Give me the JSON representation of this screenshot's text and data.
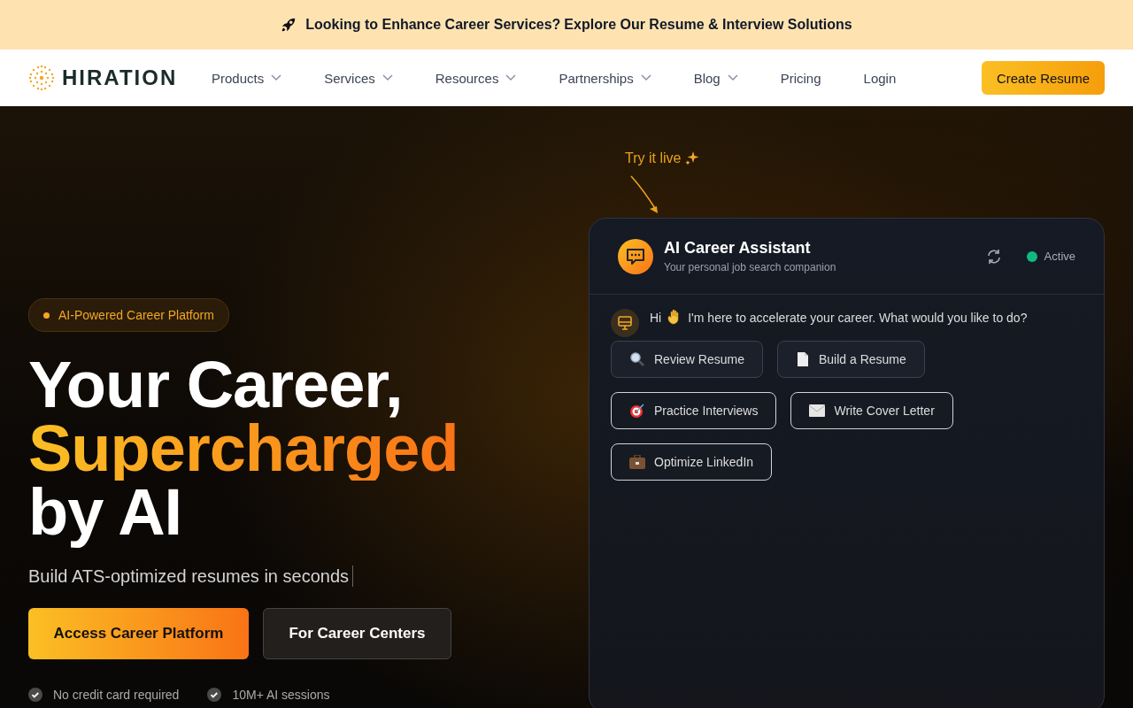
{
  "banner": {
    "question": "Looking to Enhance Career Services?",
    "link": "Explore Our Resume & Interview Solutions"
  },
  "nav": {
    "logo": "HIRATION",
    "items": [
      {
        "label": "Products",
        "dropdown": true
      },
      {
        "label": "Services",
        "dropdown": true
      },
      {
        "label": "Resources",
        "dropdown": true
      },
      {
        "label": "Partnerships",
        "dropdown": true
      },
      {
        "label": "Blog",
        "dropdown": true
      },
      {
        "label": "Pricing",
        "dropdown": false
      },
      {
        "label": "Login",
        "dropdown": false
      }
    ],
    "cta": "Create Resume"
  },
  "hero": {
    "badge": "AI-Powered Career Platform",
    "headline_1": "Your Career,",
    "headline_2": "Supercharged",
    "headline_3": "by AI",
    "subtitle": "Build ATS-optimized resumes in seconds",
    "primary_button": "Access Career Platform",
    "secondary_button": "For Career Centers",
    "features": [
      "No credit card required",
      "10M+ AI sessions"
    ]
  },
  "try_label": "Try it live",
  "chat": {
    "title": "AI Career Assistant",
    "subtitle": "Your personal job search companion",
    "status": "Active",
    "greeting": "Hi",
    "message": "I'm here to accelerate your career. What would you like to do?",
    "options": [
      {
        "label": "Review Resume",
        "selected": false
      },
      {
        "label": "Build a Resume",
        "selected": false
      },
      {
        "label": "Practice Interviews",
        "selected": true
      },
      {
        "label": "Write Cover Letter",
        "selected": true
      },
      {
        "label": "Optimize LinkedIn",
        "selected": true
      }
    ]
  }
}
